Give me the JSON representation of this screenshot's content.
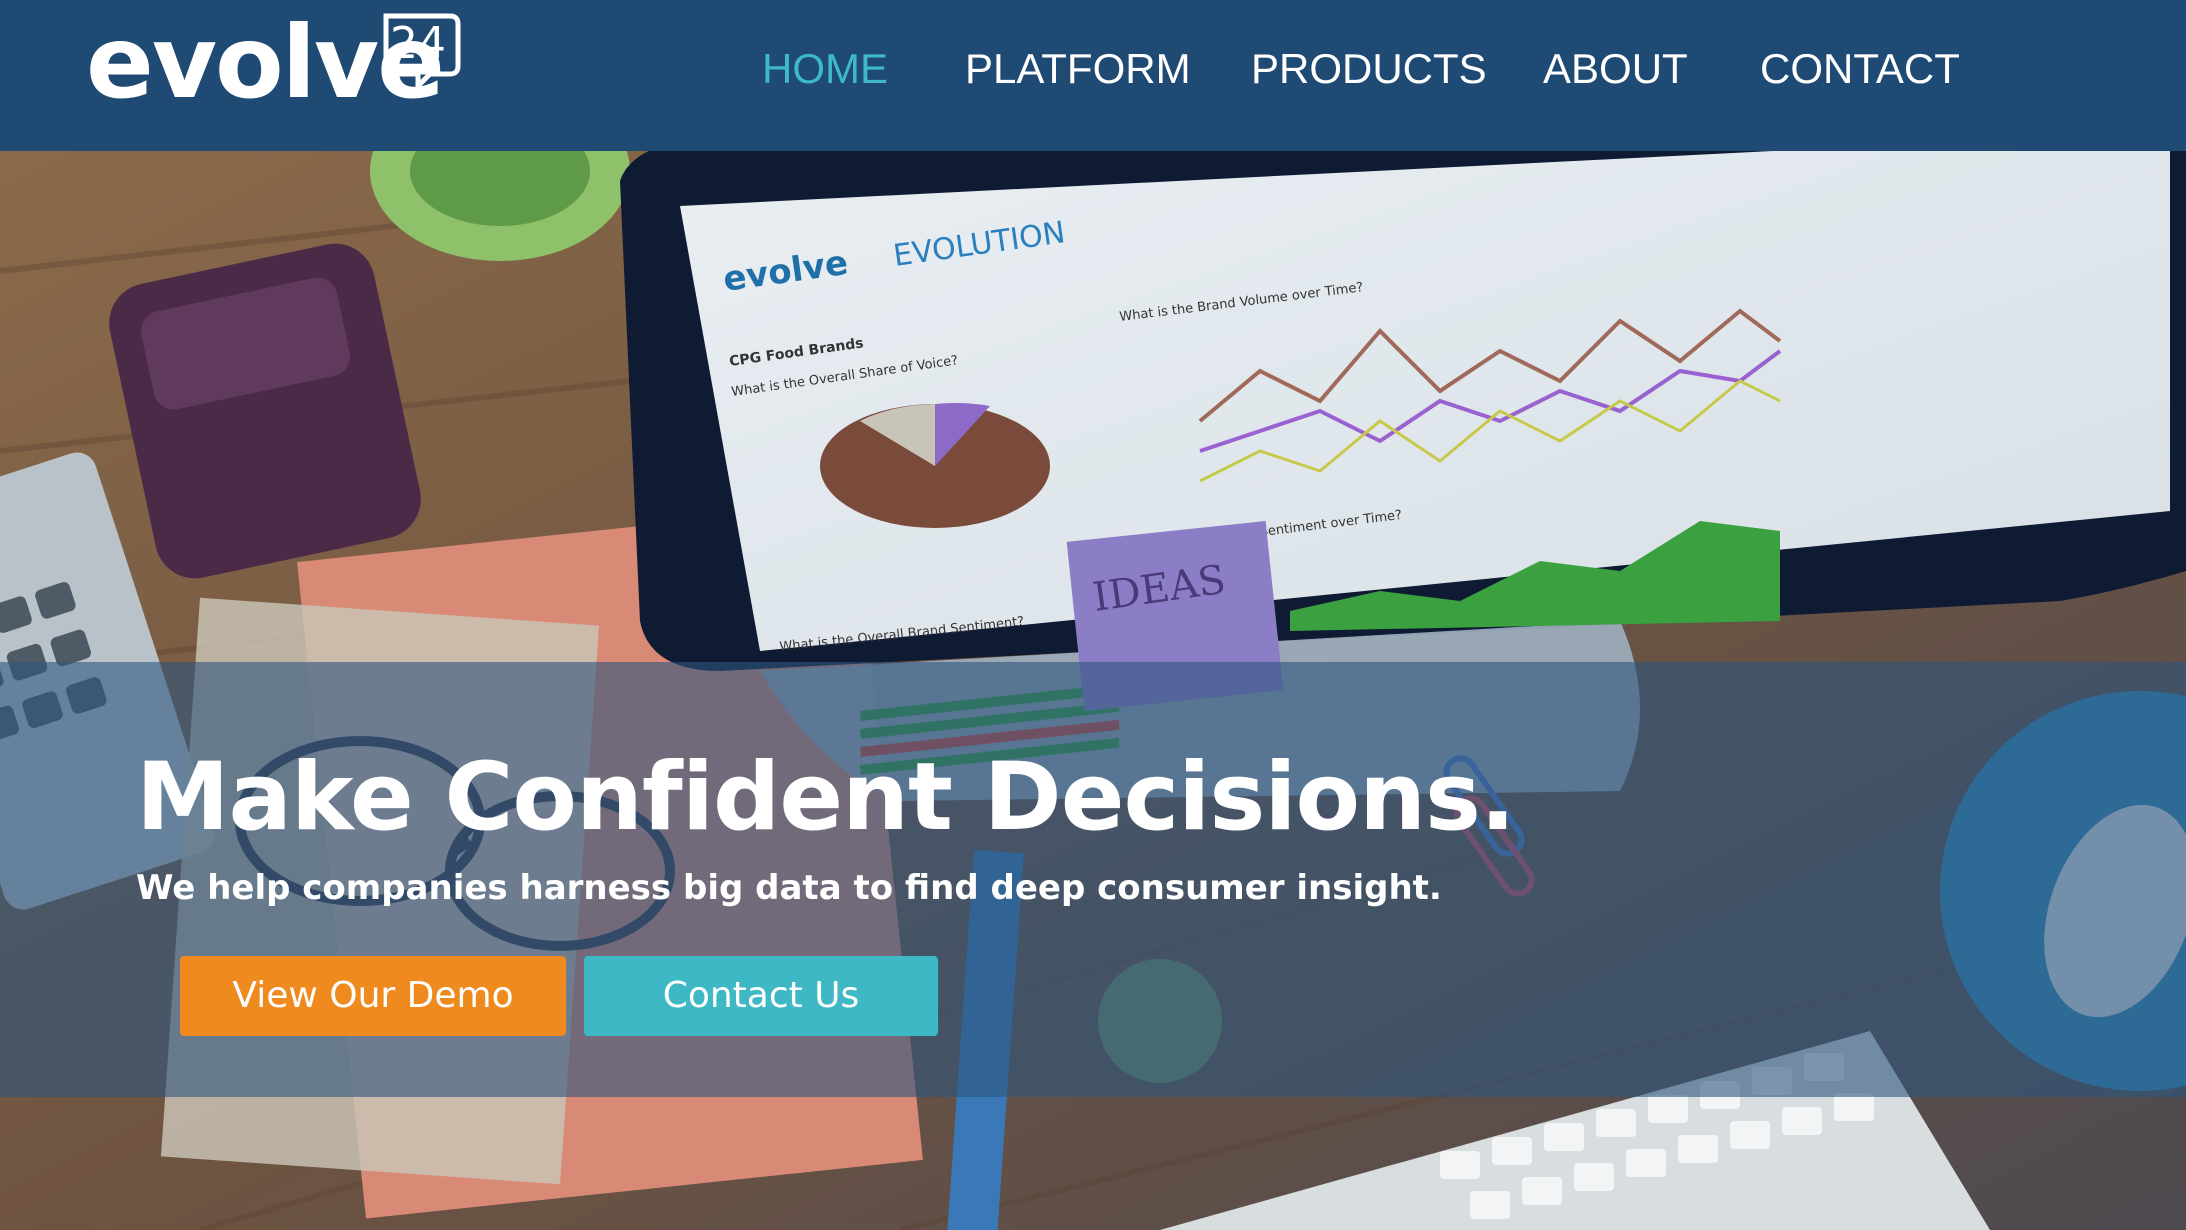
{
  "brand": {
    "logo_text": "evolve",
    "logo_badge": "24",
    "logo_color": "#ffffff"
  },
  "nav": {
    "items": [
      {
        "label": "HOME",
        "active": true
      },
      {
        "label": "PLATFORM",
        "active": false
      },
      {
        "label": "PRODUCTS",
        "active": false
      },
      {
        "label": "ABOUT",
        "active": false
      },
      {
        "label": "CONTACT",
        "active": false
      }
    ],
    "active_color": "#3fb8c8",
    "bg_color": "#1f4a73"
  },
  "hero": {
    "headline": "Make Confident Decisions.",
    "subheadline": "We help companies harness big data to find deep consumer insight.",
    "buttons": {
      "demo_label": "View Our Demo",
      "contact_label": "Contact Us"
    },
    "demo_color": "#ee8a1e",
    "contact_color": "#3db8c4"
  },
  "background_image": {
    "icons": [
      "monitor-icon",
      "keyboard-icon",
      "calculator-icon",
      "wallet-icon",
      "glasses-icon",
      "paperclip-icon",
      "mouse-icon",
      "notebook-icon",
      "plant-icon"
    ],
    "screen_text": {
      "app_logo": "evolve",
      "app_title": "EVOLUTION",
      "pie_heading": "CPG Food Brands",
      "pie_question": "What is the Overall Share of Voice?",
      "line_question": "What is the Brand Volume over Time?",
      "area_question": "What is the Brand Sentiment over Time?",
      "bars_question": "What is the Overall Brand Sentiment?",
      "note_text": "IDEAS"
    }
  }
}
